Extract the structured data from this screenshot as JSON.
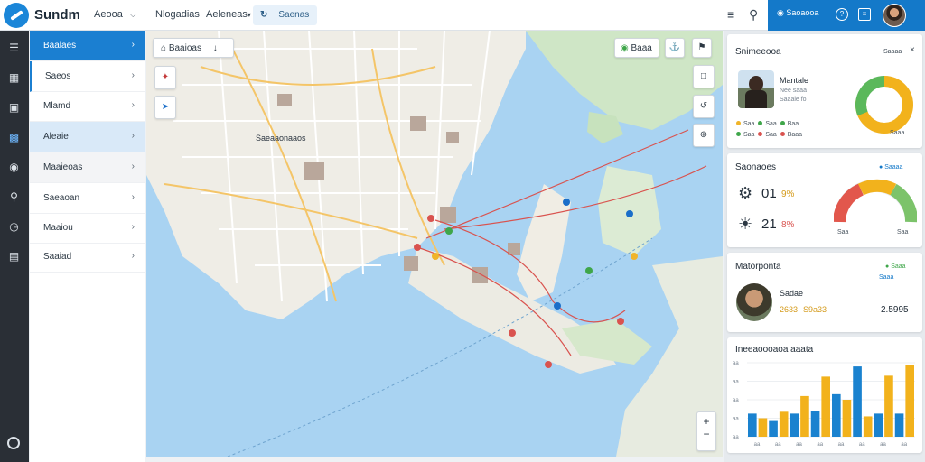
{
  "topbar": {
    "brand": "Sundm",
    "nav": [
      "Aeooa",
      "Nlogadias",
      "Aeleneas"
    ],
    "search_label": "Saenas",
    "account_label": "Saoaooa"
  },
  "menu": {
    "items": [
      {
        "label": "Baalaes",
        "state": "selected"
      },
      {
        "label": "Saeos",
        "state": "marked"
      },
      {
        "label": "Mlamd",
        "state": "normal"
      },
      {
        "label": "Aleaie",
        "state": "highlight"
      },
      {
        "label": "Maaieoas",
        "state": "soft"
      },
      {
        "label": "Saeaoan",
        "state": "normal"
      },
      {
        "label": "Maaiou",
        "state": "normal"
      },
      {
        "label": "Saaiad",
        "state": "normal"
      }
    ]
  },
  "map": {
    "search_chip": "Baaioas",
    "layer_chip": "Baaa",
    "city_label": "Saeaaonaaos"
  },
  "panel": {
    "card1": {
      "title": "Snimeeooa",
      "badge": "Saaaa",
      "person_name": "Mantale",
      "person_lines": [
        "Nee saaa",
        "Saaale fo"
      ],
      "stats_row1": [
        "Saa",
        "Saa",
        "Baa"
      ],
      "stats_row2": [
        "Saa",
        "Saa",
        "Baaa"
      ],
      "gauge_value": 0.78,
      "gauge_label": "Saaa"
    },
    "card2": {
      "title": "Saonaoes",
      "badge": "Saaaa",
      "row1_index": "01",
      "row1_value": "9%",
      "row2_index": "21",
      "row2_value": "8%",
      "gauge_value": 0.55,
      "gauge_left": "Saa",
      "gauge_right": "Saa"
    },
    "card3": {
      "title": "Matorponta",
      "badge": "Saaa",
      "badge2": "Saaa",
      "person_name": "Sadae",
      "amount_a": "2633",
      "amount_b": "S9a33",
      "amount_c": "2.5995"
    },
    "card4": {
      "title": "Ineeaoooaoa aaata",
      "y_ticks": [
        "aa",
        "aa",
        "aa",
        "aa",
        "aa"
      ],
      "x_ticks": [
        "aa",
        "aa",
        "aa",
        "aa",
        "aa",
        "aa",
        "aa",
        "aa"
      ],
      "series": [
        {
          "color": "#1a82cf",
          "values": [
            25,
            17,
            25,
            28,
            46,
            76,
            25,
            25
          ]
        },
        {
          "color": "#f2b21c",
          "values": [
            20,
            27,
            44,
            65,
            40,
            22,
            66,
            78
          ]
        }
      ],
      "max": 80
    }
  },
  "colors": {
    "accent": "#1479c9",
    "water": "#a9d3f2",
    "land": "#f1efe9",
    "route": "#d9534f"
  }
}
